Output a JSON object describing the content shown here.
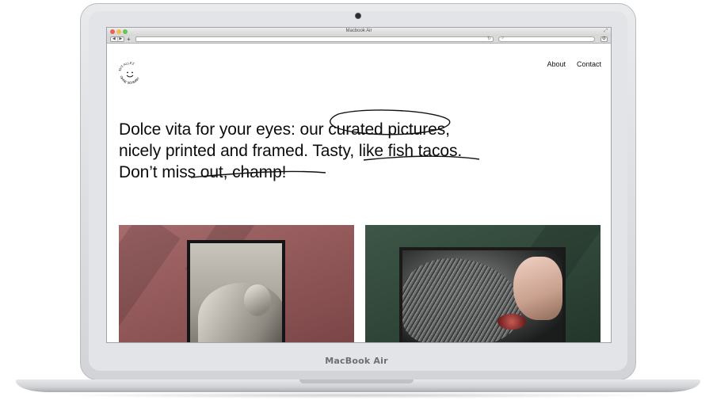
{
  "device": {
    "brand_label": "MacBook Air"
  },
  "browser": {
    "window_title": "Macbook Air",
    "search_placeholder": "Q",
    "reload_icon": "reload-icon",
    "add_tab_label": "+"
  },
  "site": {
    "logo": {
      "top_text": "MIT ALLEZ",
      "bottom_text": "OHNE SCHMÄH"
    },
    "nav": [
      {
        "label": "About"
      },
      {
        "label": "Contact"
      }
    ],
    "headline": {
      "line1": "Dolce vita for your eyes: our curated pictures,",
      "line2": "nicely printed and framed. Tasty, like fish tacos.",
      "line3": "Don’t miss out, champ!"
    }
  },
  "colors": {
    "pink_tile": "#a66b6c",
    "green_tile": "#3d5647"
  }
}
